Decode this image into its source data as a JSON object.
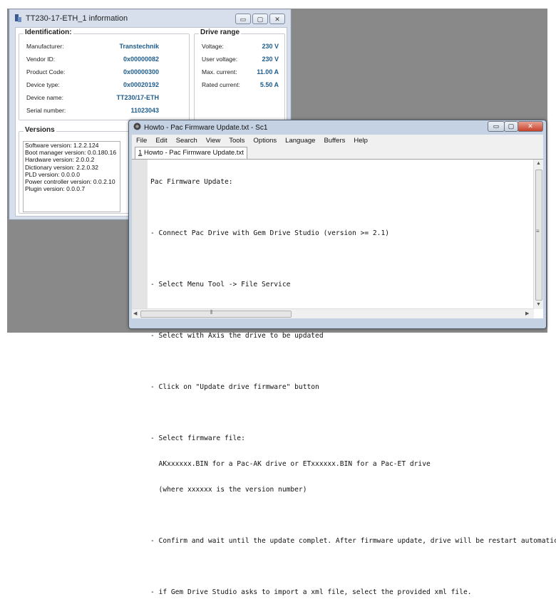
{
  "info_window": {
    "title": "TT230-17-ETH_1 information",
    "controls": {
      "minimize": "▭",
      "maximize": "▢",
      "close": "✕"
    },
    "identification": {
      "heading": "Identification:",
      "rows": [
        {
          "label": "Manufacturer:",
          "value": "Transtechnik"
        },
        {
          "label": "Vendor ID:",
          "value": "0x00000082"
        },
        {
          "label": "Product Code:",
          "value": "0x00000300"
        },
        {
          "label": "Device type:",
          "value": "0x00020192"
        },
        {
          "label": "Device name:",
          "value": "TT230/17-ETH"
        },
        {
          "label": "Serial number:",
          "value": "11023043"
        }
      ]
    },
    "drive_range": {
      "heading": "Drive range",
      "rows": [
        {
          "label": "Voltage:",
          "value": "230 V"
        },
        {
          "label": "User voltage:",
          "value": "230 V"
        },
        {
          "label": "Max. current:",
          "value": "11.00 A"
        },
        {
          "label": "Rated current:",
          "value": "5.50 A"
        }
      ]
    },
    "versions": {
      "heading": "Versions",
      "lines": [
        "Software version: 1.2.2.124",
        "Boot manager version: 0.0.180.16",
        "Hardware version: 2.0.0.2",
        "Dictionary version: 2.2.0.32",
        "PLD version: 0.0.0.0",
        "Power controller version: 0.0.2.10",
        "Plugin version: 0.0.0.7"
      ]
    }
  },
  "editor_window": {
    "title": "Howto - Pac Firmware Update.txt - Sc1",
    "controls": {
      "minimize": "▭",
      "maximize": "▢",
      "close": "✕"
    },
    "menu": [
      "File",
      "Edit",
      "Search",
      "View",
      "Tools",
      "Options",
      "Language",
      "Buffers",
      "Help"
    ],
    "tab": {
      "index": "1",
      "label": "Howto - Pac Firmware Update.txt"
    },
    "content_lines": [
      "Pac Firmware Update:",
      "",
      "- Connect Pac Drive with Gem Drive Studio (version >= 2.1)",
      "",
      "- Select Menu Tool -> File Service",
      "",
      "- Select with Axis the drive to be updated",
      "",
      "- Click on \"Update drive firmware\" button",
      "",
      "- Select firmware file:",
      "  AKxxxxxx.BIN for a Pac-AK drive or ETxxxxxx.BIN for a Pac-ET drive",
      "  (where xxxxxx is the version number)",
      "",
      "- Confirm and wait until the update complet. After firmware update, drive will be restart automatically.",
      "",
      "- if Gem Drive Studio asks to import a xml file, select the provided xml file."
    ]
  }
}
